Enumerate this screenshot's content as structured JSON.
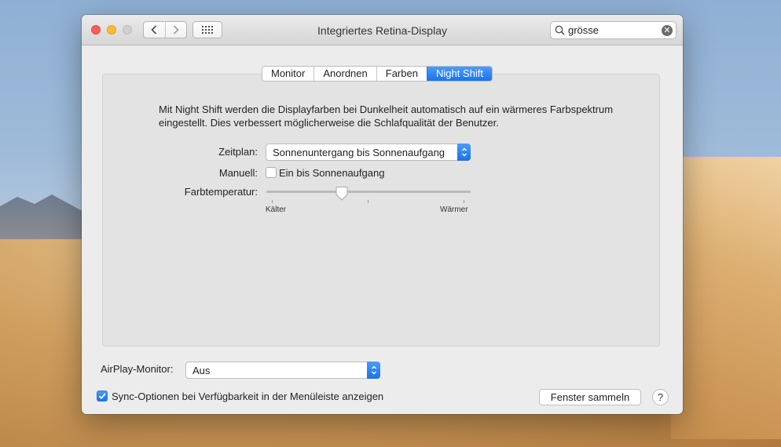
{
  "window": {
    "title": "Integriertes Retina-Display"
  },
  "toolbar": {
    "search_value": "grösse",
    "back_icon": "chevron-left-icon",
    "forward_icon": "chevron-right-icon",
    "grid_icon": "grid-icon"
  },
  "tabs": [
    {
      "label": "Monitor",
      "active": false
    },
    {
      "label": "Anordnen",
      "active": false
    },
    {
      "label": "Farben",
      "active": false
    },
    {
      "label": "Night Shift",
      "active": true
    }
  ],
  "night_shift": {
    "description": "Mit Night Shift werden die Displayfarben bei Dunkelheit automatisch auf ein wärmeres Farbspektrum eingestellt. Dies verbessert möglicherweise die Schlafqualität der Benutzer.",
    "schedule_label": "Zeitplan:",
    "schedule_value": "Sonnenuntergang bis Sonnenaufgang",
    "manual_label": "Manuell:",
    "manual_checkbox_label": "Ein bis Sonnenaufgang",
    "manual_checked": false,
    "temperature_label": "Farbtemperatur:",
    "temperature_min_label": "Kälter",
    "temperature_max_label": "Wärmer",
    "temperature_value": 0.37
  },
  "footer": {
    "airplay_label": "AirPlay-Monitor:",
    "airplay_value": "Aus",
    "sync_label": "Sync-Optionen bei Verfügbarkeit in der Menüleiste anzeigen",
    "sync_checked": true,
    "gather_button": "Fenster sammeln",
    "help_button": "?"
  },
  "colors": {
    "accent": "#1a73e8",
    "window_bg": "#ececec"
  }
}
